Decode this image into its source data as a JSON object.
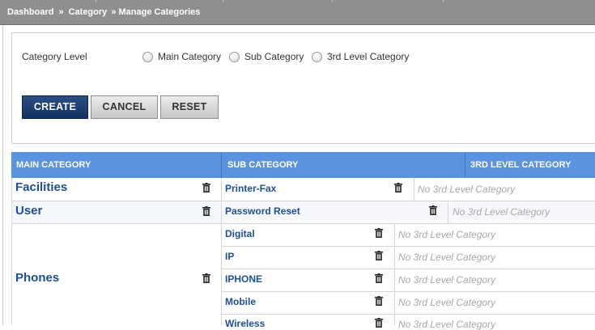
{
  "breadcrumb": {
    "items": [
      "Dashboard",
      "Category",
      "» Manage Categories"
    ],
    "separator": "»"
  },
  "form": {
    "level_label": "Category Level",
    "options": [
      "Main Category",
      "Sub Category",
      "3rd Level Category"
    ],
    "buttons": {
      "create": "CREATE",
      "cancel": "CANCEL",
      "reset": "RESET"
    }
  },
  "table": {
    "headers": [
      "MAIN CATEGORY",
      "SUB CATEGORY",
      "3RD LEVEL CATEGORY"
    ],
    "main": [
      "Facilities",
      "User",
      "Phones"
    ],
    "sub": [
      "Printer-Fax",
      "Password Reset",
      "Digital",
      "IP",
      "IPHONE",
      "Mobile",
      "Wireless"
    ],
    "third_empty": "No 3rd Level Category"
  },
  "colors": {
    "header_blue": "#5b93e0",
    "link_blue": "#1e4f95",
    "create_button": "#1b3c70",
    "breadcrumb_bar": "#8f8f8f"
  },
  "icons": {
    "delete": "trash-icon"
  }
}
